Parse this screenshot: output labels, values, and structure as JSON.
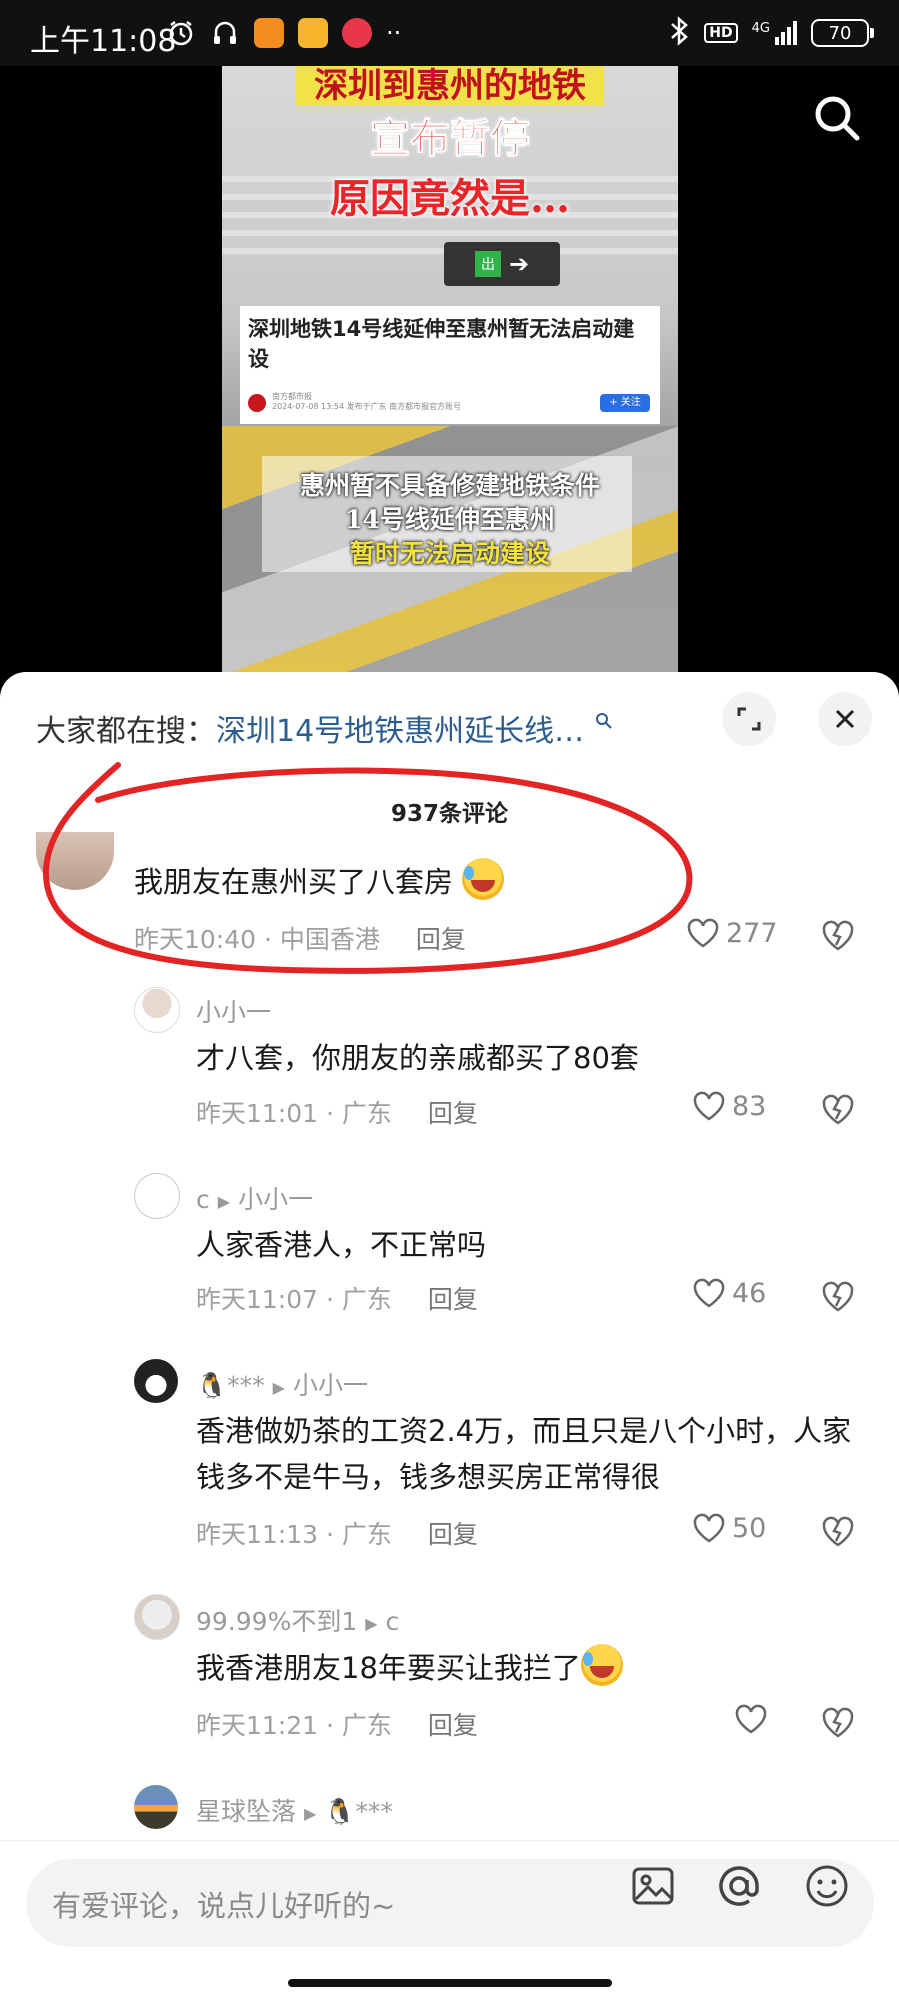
{
  "status": {
    "time": "上午11:08",
    "battery": "70",
    "network": "4G",
    "hd": "HD"
  },
  "video": {
    "caption_top": "深圳到惠州的地铁",
    "caption_line1": "宣布暂停",
    "caption_line2": "原因竟然是…",
    "sign_text": "出",
    "news_title": "深圳地铁14号线延伸至惠州暂无法启动建设",
    "news_source": "南方都市报",
    "news_meta": "2024-07-08 13:54 发布于广东 南方都市报官方账号",
    "news_follow": "+ 关注",
    "overlay_line1": "惠州暂不具备修建地铁条件",
    "overlay_line2": "14号线延伸至惠州",
    "overlay_line3": "暂时无法启动建设"
  },
  "comments_panel": {
    "suggest_prefix": "大家都在搜：",
    "suggest_keyword": "深圳14号地铁惠州延长线…",
    "count": "937条评论",
    "reply_label": "回复",
    "input_placeholder": "有爱评论，说点儿好听的~",
    "icons": [
      "search-icon",
      "expand-icon",
      "close-icon",
      "heart-icon",
      "broken-heart-icon",
      "image-icon",
      "at-icon",
      "emoji-icon"
    ]
  },
  "comments": [
    {
      "user": "",
      "reply_to": "",
      "text": "我朋友在惠州买了八套房",
      "emoji": true,
      "time": "昨天10:40",
      "location": "中国香港",
      "likes": "277"
    },
    {
      "user": "小小一",
      "reply_to": "",
      "text": "才八套，你朋友的亲戚都买了80套",
      "emoji": false,
      "time": "昨天11:01",
      "location": "广东",
      "likes": "83"
    },
    {
      "user": "c",
      "reply_to": "小小一",
      "text": "人家香港人，不正常吗",
      "emoji": false,
      "time": "昨天11:07",
      "location": "广东",
      "likes": "46"
    },
    {
      "user": "🐧***",
      "reply_to": "小小一",
      "text": "香港做奶茶的工资2.4万，而且只是八个小时，人家钱多不是牛马，钱多想买房正常得很",
      "emoji": false,
      "time": "昨天11:13",
      "location": "广东",
      "likes": "50"
    },
    {
      "user": "99.99%不到1",
      "reply_to": "c",
      "text": "我香港朋友18年要买让我拦了",
      "emoji": true,
      "time": "昨天11:21",
      "location": "广东",
      "likes": ""
    },
    {
      "user": "星球坠落",
      "reply_to": "🐧***",
      "text": "",
      "emoji": false,
      "time": "",
      "location": "",
      "likes": ""
    }
  ]
}
